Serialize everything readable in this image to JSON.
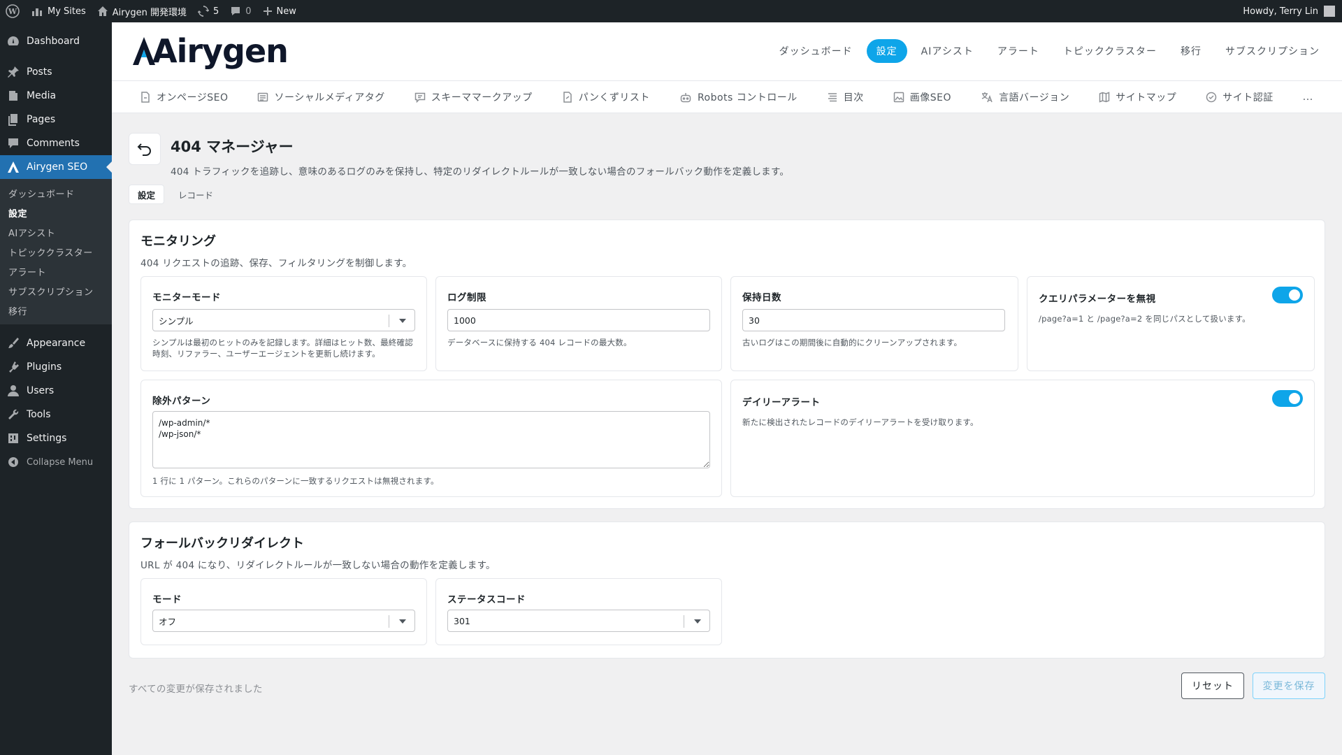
{
  "adminbar": {
    "my_sites": "My Sites",
    "site_name": "Airygen 開発環境",
    "updates_count": "5",
    "comments_count": "0",
    "new_label": "New",
    "howdy": "Howdy, Terry Lin"
  },
  "sidebar": {
    "items": [
      {
        "label": "Dashboard",
        "icon": "dashboard-icon"
      },
      {
        "label": "Posts",
        "icon": "pin-icon"
      },
      {
        "label": "Media",
        "icon": "media-icon"
      },
      {
        "label": "Pages",
        "icon": "pages-icon"
      },
      {
        "label": "Comments",
        "icon": "comment-icon"
      },
      {
        "label": "Airygen SEO",
        "icon": "airygen-icon"
      }
    ],
    "submenu": [
      "ダッシュボード",
      "設定",
      "AIアシスト",
      "トピッククラスター",
      "アラート",
      "サブスクリプション",
      "移行"
    ],
    "items2": [
      {
        "label": "Appearance",
        "icon": "brush-icon"
      },
      {
        "label": "Plugins",
        "icon": "plugin-icon"
      },
      {
        "label": "Users",
        "icon": "user-icon"
      },
      {
        "label": "Tools",
        "icon": "wrench-icon"
      },
      {
        "label": "Settings",
        "icon": "settings-icon"
      }
    ],
    "collapse": "Collapse Menu"
  },
  "header": {
    "logo": "Airygen",
    "nav": [
      "ダッシュボード",
      "設定",
      "AIアシスト",
      "アラート",
      "トピッククラスター",
      "移行",
      "サブスクリプション"
    ],
    "active_nav": "設定"
  },
  "subtabs": [
    "オンページSEO",
    "ソーシャルメディアタグ",
    "スキーママークアップ",
    "パンくずリスト",
    "Robots コントロール",
    "目次",
    "画像SEO",
    "言語バージョン",
    "サイトマップ",
    "サイト認証",
    "..."
  ],
  "page": {
    "title": "404 マネージャー",
    "description": "404 トラフィックを追跡し、意味のあるログのみを保持し、特定のリダイレクトルールが一致しない場合のフォールバック動作を定義します。",
    "tabs": [
      "設定",
      "レコード"
    ]
  },
  "monitoring": {
    "title": "モニタリング",
    "description": "404 リクエストの追跡、保存、フィルタリングを制御します。",
    "monitor_mode": {
      "label": "モニターモード",
      "value": "シンプル",
      "help": "シンプルは最初のヒットのみを記録します。詳細はヒット数、最終確認時刻、リファラー、ユーザーエージェントを更新し続けます。"
    },
    "log_limit": {
      "label": "ログ制限",
      "value": "1000",
      "help": "データベースに保持する 404 レコードの最大数。"
    },
    "retention": {
      "label": "保持日数",
      "value": "30",
      "help": "古いログはこの期間後に自動的にクリーンアップされます。"
    },
    "ignore_query": {
      "label": "クエリパラメーターを無視",
      "help": "/page?a=1 と /page?a=2 を同じパスとして扱います。",
      "enabled": true
    },
    "exclude": {
      "label": "除外パターン",
      "value": "/wp-admin/*\n/wp-json/*",
      "help": "1 行に 1 パターン。これらのパターンに一致するリクエストは無視されます。"
    },
    "daily_alert": {
      "label": "デイリーアラート",
      "help": "新たに検出されたレコードのデイリーアラートを受け取ります。",
      "enabled": true
    }
  },
  "fallback": {
    "title": "フォールバックリダイレクト",
    "description": "URL が 404 になり、リダイレクトルールが一致しない場合の動作を定義します。",
    "mode": {
      "label": "モード",
      "value": "オフ"
    },
    "status_code": {
      "label": "ステータスコード",
      "value": "301"
    }
  },
  "footer": {
    "status": "すべての変更が保存されました",
    "reset": "リセット",
    "save": "変更を保存"
  },
  "colors": {
    "accent": "#0ea5e9",
    "wp_blue": "#2271b1",
    "admin_dark": "#1d2327"
  }
}
